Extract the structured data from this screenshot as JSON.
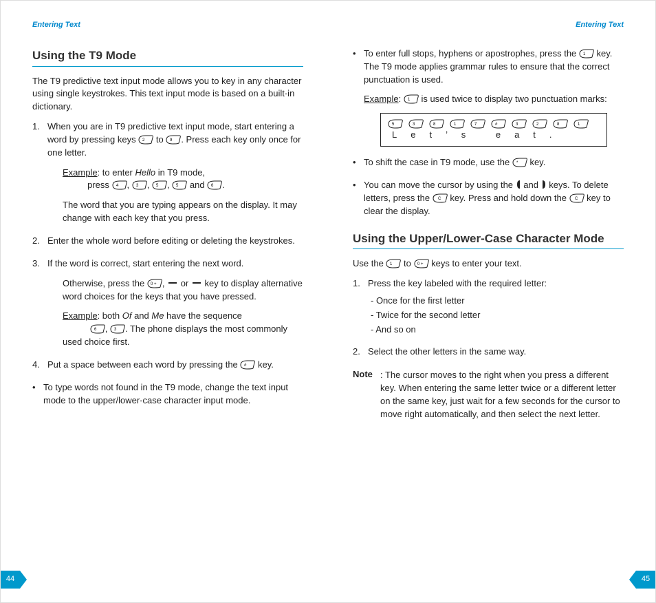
{
  "left": {
    "running_head": "Entering Text",
    "h_t9": "Using the T9 Mode",
    "intro": "The T9 predictive text input mode allows you to key in any character using single keystrokes. This text input mode is based on a built-in dictionary.",
    "li1_a": "When you are in T9 predictive text input mode, start entering a word by pressing keys ",
    "li1_b": " to ",
    "li1_c": ". Press each key only once for one letter.",
    "ex1_lbl": "Example",
    "ex1_a": ": to enter ",
    "ex1_hello": "Hello",
    "ex1_b": " in T9 mode,",
    "ex1_press": "press ",
    "ex1_and": " and ",
    "ex1_end": ".",
    "li1_tail": "The word that you are typing appears on the display. It may change with each key that you press.",
    "li2": "Enter the whole word before editing or deleting the keystrokes.",
    "li3": "If the word is correct, start entering the next word.",
    "li3_otherwise_a": "Otherwise, press the ",
    "li3_otherwise_b": " or ",
    "li3_otherwise_c": " key to display alternative word choices for the keys that you have pressed.",
    "ex2_lbl": "Example",
    "ex2_a": ": both ",
    "ex2_of": "Of",
    "ex2_b": " and ",
    "ex2_me": "Me",
    "ex2_c": " have the sequence ",
    "ex2_d": ". The phone displays the most commonly used choice first.",
    "li4_a": "Put a space between each word by pressing the ",
    "li4_b": " key.",
    "bullet1": "To type words not found in the T9 mode, change the text input mode to the upper/lower-case character input mode.",
    "page_num": "44"
  },
  "right": {
    "running_head": "Entering Text",
    "b2_a": "To enter full stops, hyphens or apostrophes, press the ",
    "b2_b": " key. The T9 mode applies grammar rules to ensure that the correct punctuation is used.",
    "ex3_lbl": "Example",
    "ex3_a": ": ",
    "ex3_b": " is used twice to display two punctuation marks:",
    "keyrow_letters": "Let’s eat.",
    "b3_a": "To shift the case in T9 mode, use the ",
    "b3_b": " key.",
    "b4_a": "You can move the cursor by using the ",
    "b4_b": " and ",
    "b4_c": " keys. To delete letters, press the ",
    "b4_d": " key. Press and hold down the ",
    "b4_e": " key to clear the display.",
    "h_case": "Using the Upper/Lower-Case Character Mode",
    "case_intro_a": "Use the ",
    "case_intro_b": " to ",
    "case_intro_c": " keys to enter your text.",
    "c_li1": "Press the key labeled with the required letter:",
    "d1": "- Once for the first letter",
    "d2": "- Twice for the second letter",
    "d3": "- And so on",
    "c_li2": "Select the other letters in the same way.",
    "note_lbl": "Note",
    "note_body": ": The cursor moves to the right when you press a different key. When entering the same letter twice or a different letter on the same key, just wait for a few seconds for the cursor to move right automatically, and then select the next letter.",
    "page_num": "45"
  },
  "chart_data": {
    "type": "table",
    "title": "Key sequence example for \"Let's eat.\"",
    "columns": [
      "key_press",
      "resulting_char"
    ],
    "rows": [
      [
        "5",
        "L"
      ],
      [
        "3",
        "e"
      ],
      [
        "8",
        "t"
      ],
      [
        "1",
        "’"
      ],
      [
        "7",
        "s"
      ],
      [
        "#",
        " "
      ],
      [
        "3",
        "e"
      ],
      [
        "2",
        "a"
      ],
      [
        "8",
        "t"
      ],
      [
        "1",
        "."
      ]
    ]
  }
}
